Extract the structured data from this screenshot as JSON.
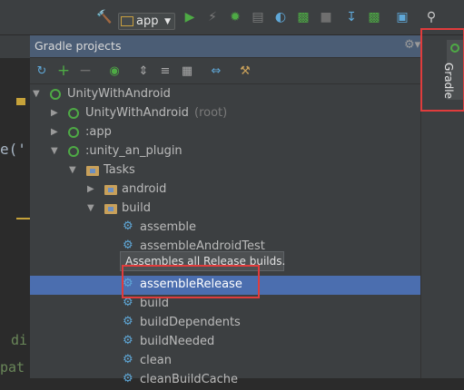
{
  "toolbar": {
    "run_config": "app",
    "icons": [
      "hammer-icon",
      "run-config-icon",
      "run-icon",
      "debug-icon",
      "attach-icon",
      "coverage-icon",
      "profile-icon",
      "android-run-icon",
      "stop-icon",
      "sdk-manager-icon",
      "avd-manager-icon",
      "project-structure-icon",
      "search-icon"
    ],
    "colors": {
      "run": "#4eaa45",
      "background": "#3c3f41"
    }
  },
  "editor": {
    "fragments": [
      "e('",
      "di",
      "pat"
    ]
  },
  "panel": {
    "title": "Gradle projects",
    "tools": [
      "refresh-icon",
      "add-icon",
      "remove-icon",
      "gradle-run-icon",
      "expand-all-icon",
      "collapse-all-icon",
      "group-icon",
      "toggle-offline-icon",
      "settings-icon"
    ],
    "header_tools": [
      "settings-gear-icon",
      "hide-panel-icon"
    ],
    "accent": "#4b6eaf"
  },
  "side_tab": {
    "label": "Gradle"
  },
  "tree": [
    {
      "label": "UnityWithAndroid",
      "suffix": "",
      "level": 0,
      "icon": "gradle",
      "arrow": "down"
    },
    {
      "label": "UnityWithAndroid",
      "suffix": "(root)",
      "level": 1,
      "icon": "gradle",
      "arrow": "right"
    },
    {
      "label": ":app",
      "suffix": "",
      "level": 1,
      "icon": "gradle",
      "arrow": "right"
    },
    {
      "label": ":unity_an_plugin",
      "suffix": "",
      "level": 1,
      "icon": "gradle",
      "arrow": "down"
    },
    {
      "label": "Tasks",
      "suffix": "",
      "level": 2,
      "icon": "folder",
      "arrow": "down"
    },
    {
      "label": "android",
      "suffix": "",
      "level": 3,
      "icon": "folder",
      "arrow": "right"
    },
    {
      "label": "build",
      "suffix": "",
      "level": 3,
      "icon": "folder",
      "arrow": "down"
    },
    {
      "label": "assemble",
      "suffix": "",
      "level": 4,
      "icon": "gear",
      "arrow": ""
    },
    {
      "label": "assembleAndroidTest",
      "suffix": "",
      "level": 4,
      "icon": "gear",
      "arrow": ""
    },
    {
      "label": "",
      "suffix": "",
      "level": 4,
      "icon": "none",
      "arrow": ""
    },
    {
      "label": "assembleRelease",
      "suffix": "",
      "level": 4,
      "icon": "gear",
      "arrow": "",
      "selected": true
    },
    {
      "label": "build",
      "suffix": "",
      "level": 4,
      "icon": "gear",
      "arrow": ""
    },
    {
      "label": "buildDependents",
      "suffix": "",
      "level": 4,
      "icon": "gear",
      "arrow": ""
    },
    {
      "label": "buildNeeded",
      "suffix": "",
      "level": 4,
      "icon": "gear",
      "arrow": ""
    },
    {
      "label": "clean",
      "suffix": "",
      "level": 4,
      "icon": "gear",
      "arrow": ""
    },
    {
      "label": "cleanBuildCache",
      "suffix": "",
      "level": 4,
      "icon": "gear",
      "arrow": ""
    }
  ],
  "tooltip": {
    "text": "Assembles all Release builds."
  },
  "highlight_color": "#e03c3c"
}
